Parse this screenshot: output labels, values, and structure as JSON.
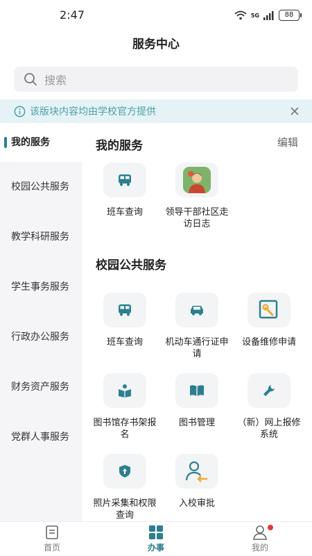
{
  "status": {
    "time": "2:47",
    "battery": "88",
    "network": "5G"
  },
  "header": {
    "title": "服务中心"
  },
  "search": {
    "placeholder": "搜索"
  },
  "notice": {
    "text": "该版块内容均由学校官方提供"
  },
  "sidebar": {
    "items": [
      {
        "label": "我的服务",
        "active": true
      },
      {
        "label": "校园公共服务"
      },
      {
        "label": "教学科研服务"
      },
      {
        "label": "学生事务服务"
      },
      {
        "label": "行政办公服务"
      },
      {
        "label": "财务资产服务"
      },
      {
        "label": "党群人事服务"
      }
    ]
  },
  "my_services": {
    "title": "我的服务",
    "edit_label": "编辑",
    "tiles": [
      {
        "label": "班车查询",
        "icon": "bus-icon"
      },
      {
        "label": "领导干部社区走访日志",
        "icon": "leader-avatar-icon"
      }
    ]
  },
  "public_services": {
    "title": "校园公共服务",
    "tiles": [
      {
        "label": "班车查询",
        "icon": "bus-icon"
      },
      {
        "label": "机动车通行证申请",
        "icon": "car-icon"
      },
      {
        "label": "设备维修申请",
        "icon": "repair-doc-icon"
      },
      {
        "label": "图书馆存书架报名",
        "icon": "reading-icon"
      },
      {
        "label": "图书管理",
        "icon": "book-icon"
      },
      {
        "label": "（新）网上报修系统",
        "icon": "wrench-icon"
      },
      {
        "label": "照片采集和权限查询",
        "icon": "shield-icon"
      },
      {
        "label": "入校审批",
        "icon": "person-entry-icon"
      }
    ]
  },
  "bottom_nav": {
    "items": [
      {
        "label": "首页",
        "icon": "home-doc-icon"
      },
      {
        "label": "办事",
        "icon": "grid-icon",
        "active": true
      },
      {
        "label": "我的",
        "icon": "user-icon"
      }
    ]
  },
  "colors": {
    "accent": "#2d7f90",
    "notice_bg": "#e6f3f6",
    "notice_text": "#4a9fa9",
    "badge": "#e53935"
  }
}
